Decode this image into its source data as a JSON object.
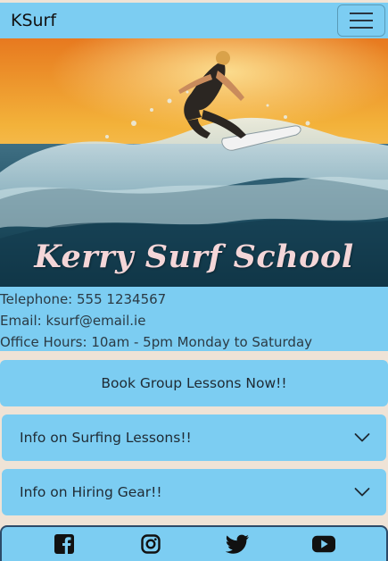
{
  "navbar": {
    "brand": "KSurf",
    "toggle_icon": "hamburger-menu-icon"
  },
  "hero": {
    "title": "Kerry Surf School"
  },
  "contact": {
    "telephone": "Telephone: 555 1234567",
    "email": "Email: ksurf@email.ie",
    "hours": "Office Hours: 10am - 5pm Monday to Saturday"
  },
  "book_button": {
    "label": "Book Group Lessons Now!!"
  },
  "accordion": [
    {
      "label": "Info on Surfing Lessons!!",
      "icon": "chevron-down-icon"
    },
    {
      "label": "Info on Hiring Gear!!",
      "icon": "chevron-down-icon"
    }
  ],
  "footer": {
    "icons": [
      "facebook-icon",
      "instagram-icon",
      "twitter-icon",
      "youtube-icon"
    ]
  },
  "colors": {
    "accent": "#7ccdf2",
    "background": "#efe3d6",
    "text": "#1f2a33",
    "hero_title": "#f4d6d8"
  }
}
